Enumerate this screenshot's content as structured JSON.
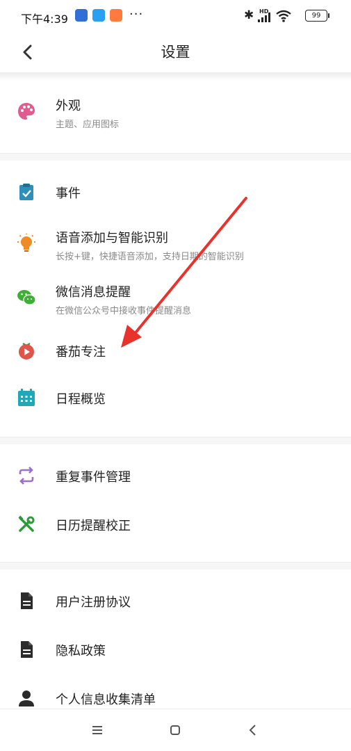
{
  "status_bar": {
    "time": "下午4:39",
    "battery": "99",
    "network": "HD"
  },
  "header": {
    "title": "设置"
  },
  "sections": [
    {
      "items": [
        {
          "label": "外观",
          "subtitle": "主题、应用图标",
          "icon": "palette-icon",
          "icon_color": "#e35b8e"
        }
      ]
    },
    {
      "items": [
        {
          "label": "事件",
          "icon": "clipboard-check-icon",
          "icon_color": "#2e8fb8"
        },
        {
          "label": "语音添加与智能识别",
          "subtitle": "长按+键，快捷语音添加，支持日期的智能识别",
          "icon": "lightbulb-icon",
          "icon_color": "#f08a24"
        },
        {
          "label": "微信消息提醒",
          "subtitle": "在微信公众号中接收事件提醒消息",
          "icon": "wechat-icon",
          "icon_color": "#3cb035"
        },
        {
          "label": "番茄专注",
          "icon": "tomato-timer-icon",
          "icon_color": "#e0554a"
        },
        {
          "label": "日程概览",
          "icon": "calendar-grid-icon",
          "icon_color": "#20a7b8"
        }
      ]
    },
    {
      "items": [
        {
          "label": "重复事件管理",
          "icon": "repeat-icon",
          "icon_color": "#9a6fd0"
        },
        {
          "label": "日历提醒校正",
          "icon": "tools-icon",
          "icon_color": "#2e9a3a"
        }
      ]
    },
    {
      "items": [
        {
          "label": "用户注册协议",
          "icon": "document-icon",
          "icon_color": "#2b2b2b"
        },
        {
          "label": "隐私政策",
          "icon": "document-icon",
          "icon_color": "#2b2b2b"
        },
        {
          "label": "个人信息收集清单",
          "icon": "person-icon",
          "icon_color": "#2b2b2b"
        }
      ]
    }
  ],
  "annotation": {
    "arrow_color": "#e8322b"
  },
  "nav": {
    "buttons": [
      "menu-icon",
      "home-icon",
      "back-icon"
    ]
  }
}
